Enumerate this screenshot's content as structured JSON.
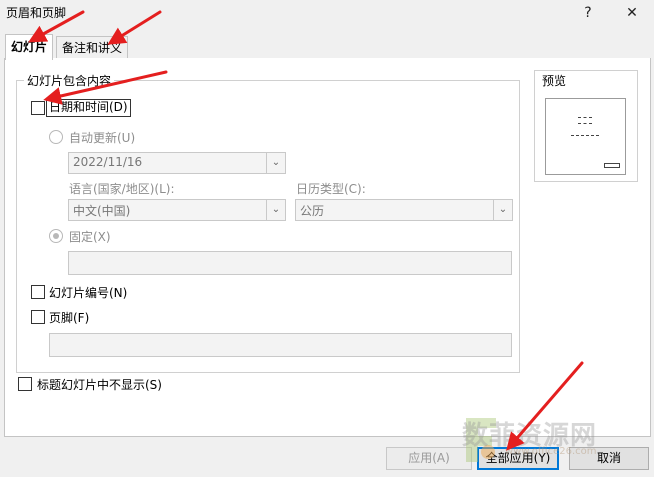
{
  "window": {
    "title": "页眉和页脚",
    "help_label": "?",
    "close_label": "✕"
  },
  "tabs": [
    {
      "label": "幻灯片",
      "active": true
    },
    {
      "label": "备注和讲义",
      "active": false
    }
  ],
  "group": {
    "label": "幻灯片包含内容",
    "date_time": {
      "label": "日期和时间(D)",
      "checked": false
    },
    "auto_update": {
      "label": "自动更新(U)",
      "value": "2022/11/16"
    },
    "language": {
      "label": "语言(国家/地区)(L):",
      "value": "中文(中国)"
    },
    "calendar": {
      "label": "日历类型(C):",
      "value": "公历"
    },
    "fixed": {
      "label": "固定(X)",
      "value": ""
    },
    "slide_number": {
      "label": "幻灯片编号(N)",
      "checked": false
    },
    "footer": {
      "label": "页脚(F)",
      "checked": false,
      "value": ""
    }
  },
  "no_title_slide": {
    "label": "标题幻灯片中不显示(S)",
    "checked": false
  },
  "preview": {
    "label": "预览"
  },
  "buttons": {
    "apply": "应用(A)",
    "apply_all": "全部应用(Y)",
    "cancel": "取消"
  },
  "watermark": {
    "text": "数菲资源网",
    "sub": "www.office26.com"
  },
  "colors": {
    "accent": "#0078d7",
    "arrow": "#e41f1f"
  }
}
